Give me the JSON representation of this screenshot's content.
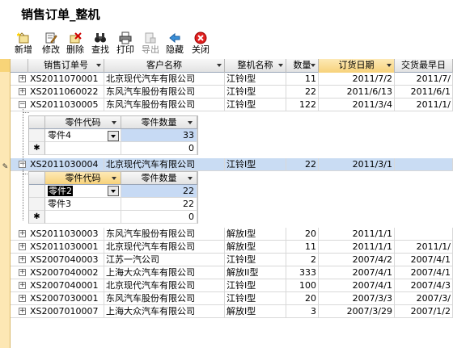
{
  "title": "销售订单_整机",
  "toolbar": [
    {
      "id": "new",
      "label": "新增",
      "icon": "new-icon",
      "disabled": false
    },
    {
      "id": "edit",
      "label": "修改",
      "icon": "edit-icon",
      "disabled": false
    },
    {
      "id": "delete",
      "label": "删除",
      "icon": "delete-icon",
      "disabled": false
    },
    {
      "id": "find",
      "label": "查找",
      "icon": "binoculars-icon",
      "disabled": false
    },
    {
      "id": "print",
      "label": "打印",
      "icon": "printer-icon",
      "disabled": false
    },
    {
      "id": "export",
      "label": "导出",
      "icon": "export-icon",
      "disabled": true
    },
    {
      "id": "hide",
      "label": "隐藏",
      "icon": "arrow-left-icon",
      "disabled": false
    },
    {
      "id": "close",
      "label": "关闭",
      "icon": "close-icon",
      "disabled": false
    }
  ],
  "columns": [
    "销售订单号",
    "客户名称",
    "整机名称",
    "数量",
    "订货日期",
    "交货最早日"
  ],
  "rows": [
    {
      "order": "XS2011070001",
      "customer": "北京现代汽车有限公司",
      "model": "江铃I型",
      "qty": "11",
      "order_date": "2011/7/2",
      "delivery": "2011/7/"
    },
    {
      "order": "XS2011060022",
      "customer": "东风汽车股份有限公司",
      "model": "江铃I型",
      "qty": "22",
      "order_date": "2011/6/13",
      "delivery": "2011/6/1"
    },
    {
      "order": "XS2011030005",
      "customer": "东风汽车股份有限公司",
      "model": "江铃I型",
      "qty": "122",
      "order_date": "2011/3/4",
      "delivery": "2011/1/"
    },
    {
      "order": "XS2011030004",
      "customer": "北京现代汽车有限公司",
      "model": "江铃I型",
      "qty": "22",
      "order_date": "2011/3/1",
      "delivery": ""
    },
    {
      "order": "XS2011030003",
      "customer": "东风汽车股份有限公司",
      "model": "解放I型",
      "qty": "20",
      "order_date": "2011/1/1",
      "delivery": ""
    },
    {
      "order": "XS2011030001",
      "customer": "北京现代汽车有限公司",
      "model": "解放I型",
      "qty": "11",
      "order_date": "2011/1/1",
      "delivery": "2011/1/"
    },
    {
      "order": "XS2007040003",
      "customer": "江苏一汽公司",
      "model": "江铃I型",
      "qty": "2",
      "order_date": "2007/4/2",
      "delivery": "2007/4/1"
    },
    {
      "order": "XS2007040002",
      "customer": "上海大众汽车有限公司",
      "model": "解放II型",
      "qty": "333",
      "order_date": "2007/4/1",
      "delivery": "2007/4/1"
    },
    {
      "order": "XS2007040001",
      "customer": "北京现代汽车有限公司",
      "model": "江铃I型",
      "qty": "100",
      "order_date": "2007/4/1",
      "delivery": "2007/4/3"
    },
    {
      "order": "XS2007030001",
      "customer": "东风汽车股份有限公司",
      "model": "江铃I型",
      "qty": "20",
      "order_date": "2007/3/3",
      "delivery": "2007/3/"
    },
    {
      "order": "XS2007010007",
      "customer": "上海大众汽车有限公司",
      "model": "解放I型",
      "qty": "3",
      "order_date": "2007/3/29",
      "delivery": "2007/1/2"
    }
  ],
  "sub1": {
    "headers": [
      "零件代码",
      "零件数量"
    ],
    "rows": [
      {
        "part": "零件4",
        "qty": "33"
      }
    ],
    "new_qty": "0"
  },
  "sub2": {
    "headers": [
      "零件代码",
      "零件数量"
    ],
    "rows": [
      {
        "part": "零件2",
        "qty": "22"
      },
      {
        "part": "零件3",
        "qty": "22"
      }
    ],
    "new_qty": "0"
  },
  "glyphs": {
    "expand": "+",
    "collapse": "−",
    "new_row": "✱",
    "pencil": "✎"
  },
  "colors": {
    "current_row": "#c9dcf3",
    "selector": "#fde7b4",
    "highlight": "#c7daf4"
  }
}
